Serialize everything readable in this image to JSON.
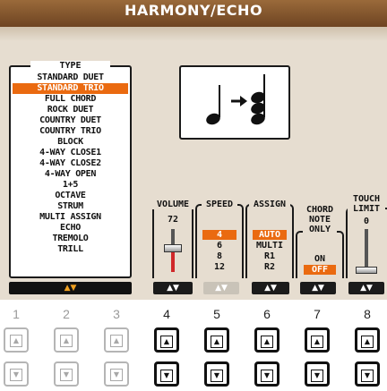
{
  "title": "HARMONY/ECHO",
  "type_panel": {
    "label": "TYPE",
    "items": [
      "STANDARD DUET",
      "STANDARD TRIO",
      "FULL CHORD",
      "ROCK DUET",
      "COUNTRY DUET",
      "COUNTRY TRIO",
      "BLOCK",
      "4-WAY CLOSE1",
      "4-WAY CLOSE2",
      "4-WAY OPEN",
      "1+5",
      "OCTAVE",
      "STRUM",
      "MULTI ASSIGN",
      "ECHO",
      "TREMOLO",
      "TRILL"
    ],
    "selected_index": 1
  },
  "volume": {
    "label": "VOLUME",
    "value": "72",
    "level": 0.57
  },
  "speed": {
    "label": "SPEED",
    "options": [
      "4",
      "6",
      "8",
      "12"
    ],
    "selected_index": 0
  },
  "assign": {
    "label": "ASSIGN",
    "options": [
      "AUTO",
      "MULTI",
      "R1",
      "R2"
    ],
    "selected_index": 0
  },
  "chord_note_only": {
    "label_lines": [
      "CHORD",
      "NOTE",
      "ONLY"
    ],
    "options": [
      "ON",
      "OFF"
    ],
    "selected_index": 1
  },
  "touch_limit": {
    "label_lines": [
      "TOUCH",
      "LIMIT"
    ],
    "value": "0",
    "level": 0.0
  },
  "bottom_arrows": "▲▼",
  "buttons": {
    "numbers": [
      "1",
      "2",
      "3",
      "4",
      "5",
      "6",
      "7",
      "8"
    ],
    "up_symbol": "▲",
    "down_symbol": "▼",
    "enabled": [
      false,
      false,
      false,
      true,
      true,
      true,
      true,
      true
    ]
  },
  "colors": {
    "accent": "#ea6a10",
    "title_bar": "#7a4c26",
    "screen_bg": "#e6ddd0",
    "fader_red": "#d0282a"
  }
}
